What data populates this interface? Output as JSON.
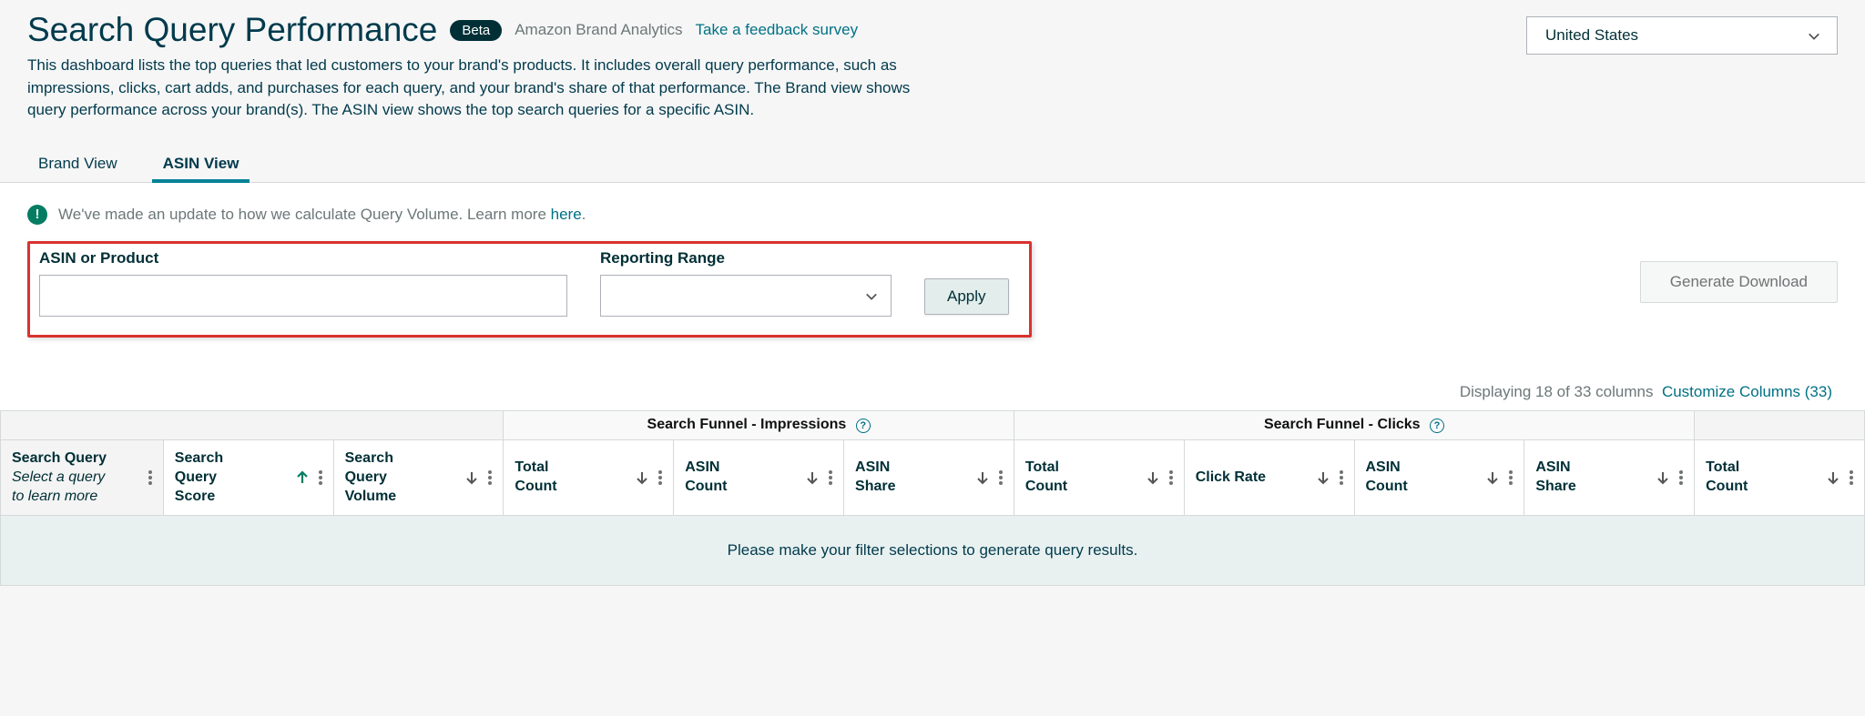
{
  "header": {
    "title": "Search Query Performance",
    "badge": "Beta",
    "program": "Amazon Brand Analytics",
    "feedback_link": "Take a feedback survey",
    "description": "This dashboard lists the top queries that led customers to your brand's products. It includes overall query performance, such as impressions, clicks, cart adds, and purchases for each query, and your brand's share of that performance. The Brand view shows query performance across your brand(s). The ASIN view shows the top search queries for a specific ASIN."
  },
  "marketplace": {
    "selected": "United States"
  },
  "tabs": {
    "brand": "Brand View",
    "asin": "ASIN View"
  },
  "notice": {
    "text_before": "We've made an update to how we calculate Query Volume. Learn more ",
    "link": "here",
    "text_after": "."
  },
  "filters": {
    "asin_label": "ASIN or Product",
    "asin_value": "",
    "range_label": "Reporting Range",
    "range_value": "",
    "apply": "Apply",
    "generate_download": "Generate Download"
  },
  "columns_info": {
    "displaying": "Displaying 18 of 33 columns",
    "customize": "Customize Columns (33)"
  },
  "table": {
    "groups": {
      "impressions": "Search Funnel - Impressions",
      "clicks": "Search Funnel - Clicks"
    },
    "cols": {
      "c0_l1": "Search Query",
      "c0_l2": "Select a query",
      "c0_l3": "to learn more",
      "c1_l1": "Search",
      "c1_l2": "Query",
      "c1_l3": "Score",
      "c2_l1": "Search",
      "c2_l2": "Query",
      "c2_l3": "Volume",
      "c3_l1": "Total",
      "c3_l2": "Count",
      "c4_l1": "ASIN",
      "c4_l2": "Count",
      "c5_l1": "ASIN",
      "c5_l2": "Share",
      "c6_l1": "Total",
      "c6_l2": "Count",
      "c7_l1": "Click Rate",
      "c8_l1": "ASIN",
      "c8_l2": "Count",
      "c9_l1": "ASIN",
      "c9_l2": "Share",
      "c10_l1": "Total",
      "c10_l2": "Count"
    },
    "placeholder": "Please make your filter selections to generate query results."
  }
}
